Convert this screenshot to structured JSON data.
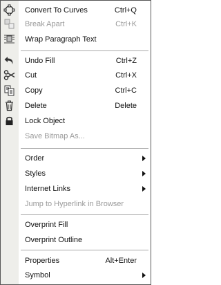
{
  "menu": {
    "items": [
      {
        "label": "Convert To Curves",
        "shortcut": "Ctrl+Q",
        "icon": "convert-to-curves-icon"
      },
      {
        "label": "Break  Apart",
        "shortcut": "Ctrl+K",
        "icon": "break-apart-icon",
        "disabled": true
      },
      {
        "label": "Wrap Paragraph Text",
        "icon": "wrap-paragraph-text-icon"
      },
      {
        "label": "Undo Fill",
        "shortcut": "Ctrl+Z",
        "icon": "undo-icon"
      },
      {
        "label": "Cut",
        "shortcut": "Ctrl+X",
        "icon": "scissors-icon"
      },
      {
        "label": "Copy",
        "shortcut": "Ctrl+C",
        "icon": "copy-icon"
      },
      {
        "label": "Delete",
        "shortcut": "Delete",
        "icon": "trash-icon"
      },
      {
        "label": "Lock Object",
        "icon": "lock-icon"
      },
      {
        "label": "Save Bitmap As...",
        "disabled": true
      },
      {
        "label": "Order",
        "submenu": true
      },
      {
        "label": "Styles",
        "submenu": true
      },
      {
        "label": "Internet Links",
        "submenu": true
      },
      {
        "label": "Jump to Hyperlink in Browser",
        "disabled": true
      },
      {
        "label": "Overprint Fill"
      },
      {
        "label": "Overprint Outline"
      },
      {
        "label": "Properties",
        "shortcut": "Alt+Enter"
      },
      {
        "label": "Symbol",
        "submenu": true
      }
    ]
  }
}
